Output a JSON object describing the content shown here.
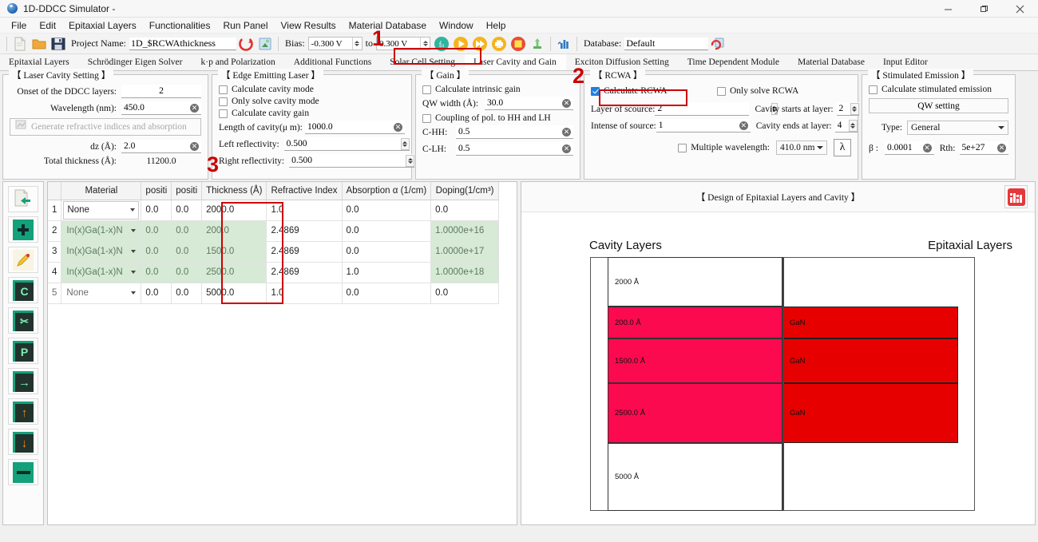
{
  "window": {
    "title": "1D-DDCC Simulator -",
    "minimize": "–",
    "maximize": "❐",
    "close": "✕"
  },
  "menu": [
    "File",
    "Edit",
    "Epitaxial Layers",
    "Functionalities",
    "Run Panel",
    "View Results",
    "Material Database",
    "Window",
    "Help"
  ],
  "toolbar": {
    "project_label": "Project Name:",
    "project_value": "1D_$RCWAthickness",
    "bias_label": "Bias:",
    "bias_from": "-0.300 V",
    "bias_to_label": "to",
    "bias_to": "0.300 V",
    "database_label": "Database:",
    "database_value": "Default"
  },
  "tabs": [
    {
      "label": "Epitaxial Layers",
      "active": false
    },
    {
      "label": "Schrödinger Eigen Solver",
      "active": false
    },
    {
      "label": "k·p and Polarization",
      "active": false
    },
    {
      "label": "Additional Functions",
      "active": false
    },
    {
      "label": "Solar Cell Setting",
      "active": false
    },
    {
      "label": "Laser Cavity and Gain",
      "active": true
    },
    {
      "label": "Exciton Diffusion Setting",
      "active": false
    },
    {
      "label": "Time Dependent Module",
      "active": false
    },
    {
      "label": "Material Database",
      "active": false
    },
    {
      "label": "Input Editor",
      "active": false
    }
  ],
  "annotations": {
    "one": "1",
    "two": "2",
    "three": "3"
  },
  "laser_cavity_setting": {
    "title": "【 Laser Cavity Setting 】",
    "onset_label": "Onset of the DDCC layers:",
    "onset_value": "2",
    "wavelength_label": "Wavelength (nm):",
    "wavelength_value": "450.0",
    "generate_button": "Generate refractive indices and absorption",
    "dz_label": "dz (Å):",
    "dz_value": "2.0",
    "total_thickness_label": "Total thickness (Å):",
    "total_thickness_value": "11200.0"
  },
  "edge_emitting_laser": {
    "title": "【 Edge Emitting Laser 】",
    "cb_calc_cavity_mode": "Calculate cavity mode",
    "cb_only_solve_cavity_mode": "Only solve cavity mode",
    "cb_calc_cavity_gain": "Calculate cavity gain",
    "length_label": "Length of cavity(μ m):",
    "length_value": "1000.0",
    "left_label": "Left reflectivity:",
    "left_value": "0.500",
    "right_label": "Right reflectivity:",
    "right_value": "0.500"
  },
  "gain": {
    "title": "【 Gain 】",
    "cb_calc_intrinsic_gain": "Calculate intrinsic gain",
    "qw_label": "QW width (Å):",
    "qw_value": "30.0",
    "cb_coupling": "Coupling of pol. to HH and LH",
    "chh_label": "C-HH:",
    "chh_value": "0.5",
    "clh_label": "C-LH:",
    "clh_value": "0.5"
  },
  "rcwa": {
    "title": "【 RCWA 】",
    "cb_calculate_rcwa": "Calculate RCWA",
    "cb_calculate_rcwa_checked": true,
    "cb_only_solve_rcwa": "Only solve RCWA",
    "layer_source_label": "Layer of scource:",
    "layer_source_value": "2",
    "intense_source_label": "Intense of source:",
    "intense_source_value": "1",
    "cavity_starts_label": "Cavity starts at layer:",
    "cavity_starts_value": "2",
    "cavity_ends_label": "Cavity ends at layer:",
    "cavity_ends_value": "4",
    "cb_multiple_wavelength": "Multiple wavelength:",
    "wavelength_option": "410.0 nm",
    "lambda_button": "λ"
  },
  "stimulated_emission": {
    "title": "【 Stimulated Emission 】",
    "cb_calc_stim": "Calculate stimulated emission",
    "qw_setting_button": "QW setting",
    "type_label": "Type:",
    "type_value": "General",
    "beta_label": "β :",
    "beta_value": "0.0001",
    "rth_label": "Rth:",
    "rth_value": "5e+27"
  },
  "side_tools": [
    {
      "name": "import-layers",
      "glyph": "←"
    },
    {
      "name": "add-layer",
      "glyph": "✚"
    },
    {
      "name": "edit-layer",
      "glyph": "✎"
    },
    {
      "name": "copy-layer",
      "glyph": "C"
    },
    {
      "name": "cut-layer",
      "glyph": "✂"
    },
    {
      "name": "paste-layer",
      "glyph": "P"
    },
    {
      "name": "insert-layer",
      "glyph": "→"
    },
    {
      "name": "move-up",
      "glyph": "↑"
    },
    {
      "name": "move-down",
      "glyph": "↓"
    },
    {
      "name": "delete-layer",
      "glyph": "━"
    }
  ],
  "table": {
    "columns": [
      "Material",
      "positi",
      "positi",
      "Thickness (Å)",
      "Refractive Index",
      "Absorption α (1/cm)",
      "Doping(1/cm³)"
    ],
    "rows": [
      {
        "n": "1",
        "material": "None",
        "p1": "0.0",
        "p2": "0.0",
        "thickness": "2000.0",
        "refractive": "1.0",
        "absorption": "0.0",
        "doping": "0.0",
        "green": false,
        "dim": false
      },
      {
        "n": "2",
        "material": "In(x)Ga(1-x)N",
        "p1": "0.0",
        "p2": "0.0",
        "thickness": "200.0",
        "refractive": "2.4869",
        "absorption": "0.0",
        "doping": "1.0000e+16",
        "green": true,
        "dim": true
      },
      {
        "n": "3",
        "material": "In(x)Ga(1-x)N",
        "p1": "0.0",
        "p2": "0.0",
        "thickness": "1500.0",
        "refractive": "2.4869",
        "absorption": "0.0",
        "doping": "1.0000e+17",
        "green": true,
        "dim": true
      },
      {
        "n": "4",
        "material": "In(x)Ga(1-x)N",
        "p1": "0.0",
        "p2": "0.0",
        "thickness": "2500.0",
        "refractive": "2.4869",
        "absorption": "1.0",
        "doping": "1.0000e+18",
        "green": true,
        "dim": true
      },
      {
        "n": "5",
        "material": "None",
        "p1": "0.0",
        "p2": "0.0",
        "thickness": "5000.0",
        "refractive": "1.0",
        "absorption": "0.0",
        "doping": "0.0",
        "green": false,
        "dim": true
      }
    ]
  },
  "diagram": {
    "title": "【 Design of Epitaxial Layers and Cavity 】",
    "chart_button_icon": "bar-chart-icon",
    "cavity_header": "Cavity Layers",
    "epitaxial_header": "Epitaxial Layers",
    "cavity_layers": [
      {
        "label": "2000 Å",
        "color": "#ffffff"
      },
      {
        "label": "200.0 Å",
        "color": "#fb0a4f"
      },
      {
        "label": "1500.0 Å",
        "color": "#fb0a4f"
      },
      {
        "label": "2500.0 Å",
        "color": "#fb0a4f"
      },
      {
        "label": "5000 Å",
        "color": "#ffffff"
      }
    ],
    "epitaxial_layers": [
      {
        "label": "",
        "color": "#ffffff"
      },
      {
        "label": "GaN",
        "color": "#e60000"
      },
      {
        "label": "GaN",
        "color": "#e60000"
      },
      {
        "label": "GaN",
        "color": "#e60000"
      },
      {
        "label": "",
        "color": "#ffffff"
      }
    ]
  },
  "colors": {
    "accent_red": "#cc0000",
    "green_row": "#d6ead6",
    "cavity_pink": "#fb0a4f",
    "epitaxial_red": "#e60000",
    "checkbox_blue": "#1f7fe0"
  }
}
